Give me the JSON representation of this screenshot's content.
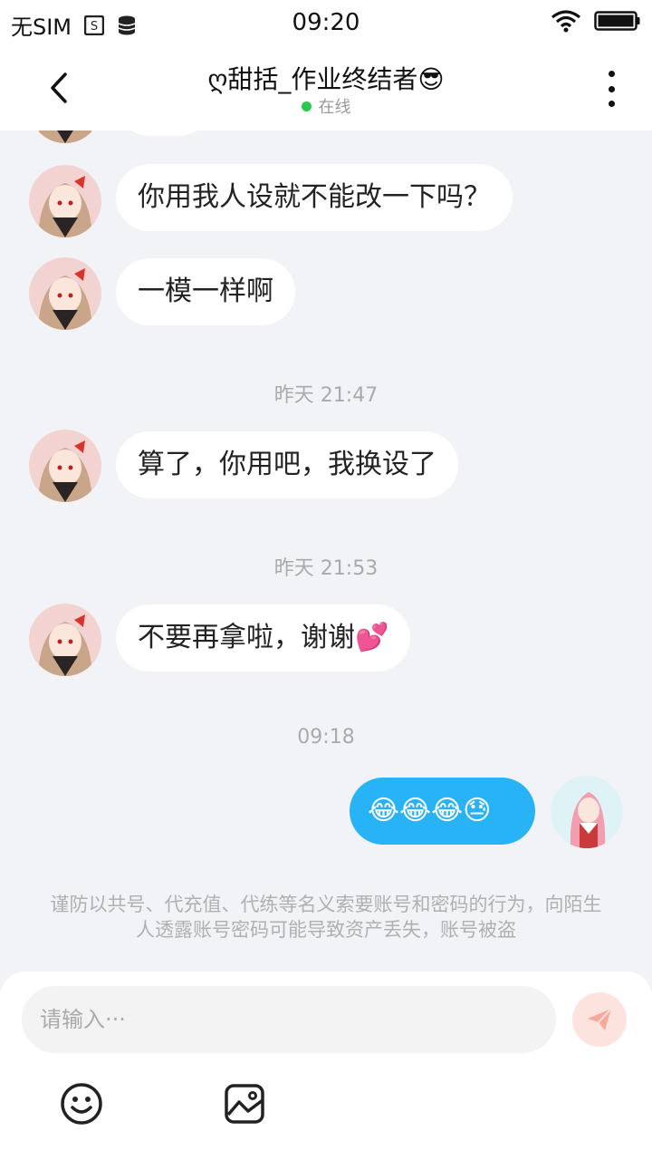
{
  "status_bar": {
    "carrier": "无SIM",
    "time": "09:20"
  },
  "header": {
    "title": "ღ甜括_作业终结者😎",
    "status": "在线"
  },
  "messages": [
    {
      "text": "你用我人设就不能改一下吗？"
    },
    {
      "text": "一模一样啊"
    },
    {
      "time": "昨天 21:47"
    },
    {
      "text": "算了，你用吧，我换设了"
    },
    {
      "time": "昨天 21:53"
    },
    {
      "text": "不要再拿啦，谢谢💕"
    },
    {
      "time": "09:18"
    },
    {
      "text": "😂😂😂😓",
      "mine": true
    }
  ],
  "notice": "谨防以共号、代充值、代练等名义索要账号和密码的行为，向陌生人透露账号密码可能导致资产丢失，账号被盗",
  "input": {
    "placeholder": "请输入···"
  },
  "colors": {
    "accent": "#27b3f5",
    "online": "#2dc84d",
    "send_bg": "#fde3de"
  },
  "icons": [
    "back-arrow-icon",
    "more-icon",
    "wifi-icon",
    "battery-icon",
    "send-icon",
    "emoji-icon",
    "image-icon"
  ]
}
